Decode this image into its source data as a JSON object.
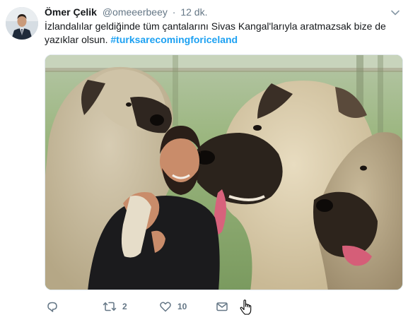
{
  "tweet": {
    "author": {
      "name": "Ömer Çelik",
      "handle": "@omeeerbeey"
    },
    "separator": "·",
    "time": "12 dk.",
    "text": "İzlandalılar geldiğinde tüm çantalarını Sivas Kangal'larıyla aratmazsak bize de yazıklar olsun.",
    "hashtag": "#turksarecomingforiceland",
    "media": {
      "icon": "photo-of-kangal-dogs-with-man"
    },
    "actions": {
      "reply_icon": "reply-icon",
      "retweet_icon": "retweet-icon",
      "retweet_count": "2",
      "like_icon": "heart-icon",
      "like_count": "10",
      "dm_icon": "envelope-icon"
    }
  },
  "colors": {
    "link": "#1da1f2",
    "secondary_text": "#657786",
    "primary_text": "#14171a"
  }
}
